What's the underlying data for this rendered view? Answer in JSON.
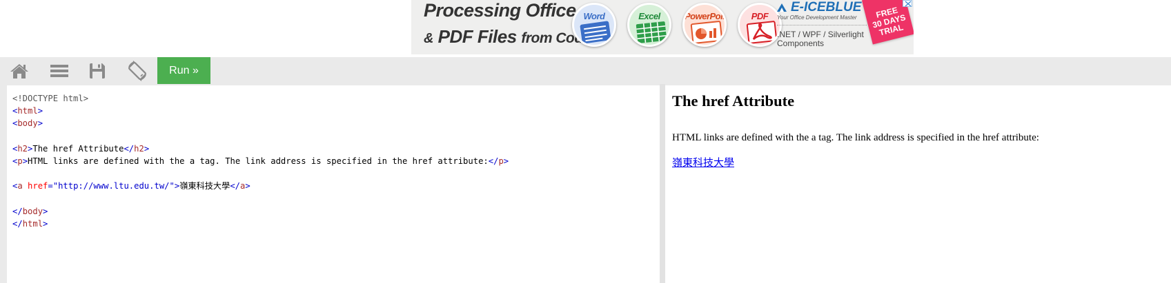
{
  "ad": {
    "headline_line1": "Processing Office",
    "headline_line2_amp": "&",
    "headline_line2_main": " PDF Files ",
    "headline_line2_tail": "from Code",
    "products": [
      {
        "name": "Word",
        "color": "#3b6fc7",
        "bg": "#dbe6f8"
      },
      {
        "name": "Excel",
        "color": "#1f8a3a",
        "bg": "#d6f0d8"
      },
      {
        "name": "PowerPoint",
        "color": "#d4441c",
        "bg": "#fde0d6"
      },
      {
        "name": "PDF",
        "color": "#d71f26",
        "bg": "#fde1e1"
      }
    ],
    "brand_name": "E-ICEBLUE",
    "brand_tagline": "Your Office Development Master",
    "brand_platforms": ".NET / WPF / Silverlight Components",
    "trial_lines": [
      "FREE",
      "30 DAYS",
      "TRIAL"
    ],
    "brand_color": "#1f6fb6",
    "trial_color": "#ee3366"
  },
  "toolbar": {
    "icons": [
      "home-icon",
      "menu-icon",
      "save-icon",
      "rotate-icon"
    ],
    "run_label": "Run »",
    "run_color": "#4caf50"
  },
  "code": {
    "doctype": "<!DOCTYPE html>",
    "html_tag": "html",
    "body_tag": "body",
    "h2_tag": "h2",
    "h2_text": "The href Attribute",
    "p_tag": "p",
    "p_text": "HTML links are defined with the a tag. The link address is specified in the href attribute:",
    "a_tag": "a",
    "a_attr": "href",
    "a_value": "\"http://www.ltu.edu.tw/\"",
    "a_text": "嶺東科技大學",
    "lt": "<",
    "gt": ">",
    "close_lt": "</",
    "eq": "="
  },
  "result": {
    "heading": "The href Attribute",
    "paragraph": "HTML links are defined with the a tag. The link address is specified in the href attribute:",
    "link_text": "嶺東科技大學",
    "link_color": "#0000ee"
  }
}
